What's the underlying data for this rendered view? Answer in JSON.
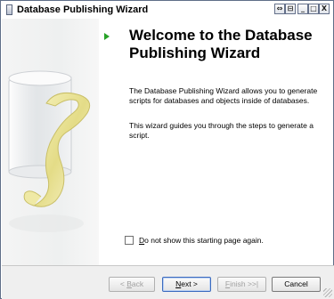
{
  "window": {
    "title": "Database Publishing Wizard",
    "titlebar_buttons": [
      "⇔",
      "⊟",
      "_",
      "□",
      "X"
    ]
  },
  "content": {
    "heading": "Welcome to the Database Publishing Wizard",
    "paragraph1": "The Database Publishing Wizard allows you to generate scripts for databases and objects inside of databases.",
    "paragraph2": "This wizard guides you through the steps to generate a script.",
    "checkbox_label_prefix": "D",
    "checkbox_label_rest": "o not show this starting page again.",
    "checkbox_checked": false
  },
  "buttons": {
    "back_prefix": "< ",
    "back_u": "B",
    "back_rest": "ack",
    "next_u": "N",
    "next_rest": "ext >",
    "finish_u": "F",
    "finish_rest": "inish >>|",
    "cancel": "Cancel"
  },
  "colors": {
    "accent_play": "#27a127",
    "default_button_border": "#3b6bbf"
  },
  "icons": {
    "title": "window-icon",
    "step": "play-arrow-icon"
  }
}
